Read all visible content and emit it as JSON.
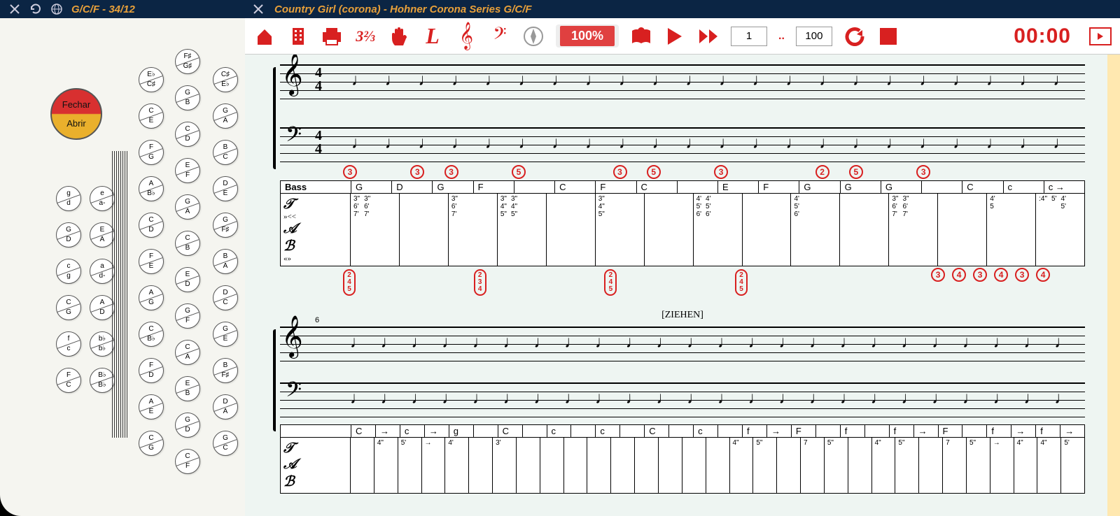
{
  "topbar": {
    "left_title": "G/C/F - 34/12",
    "right_title": "Country Girl (corona) - Hohner Corona Series G/C/F"
  },
  "fechar": "Fechar",
  "abrir": "Abrir",
  "accordion_buttons": {
    "col_a": [
      {
        "t": "g",
        "b": "d"
      },
      {
        "t": "G",
        "b": "D"
      },
      {
        "t": "c",
        "b": "g"
      },
      {
        "t": "C",
        "b": "G"
      },
      {
        "t": "f",
        "b": "c"
      },
      {
        "t": "F",
        "b": "C"
      }
    ],
    "col_b": [
      {
        "t": "e",
        "b": "a-"
      },
      {
        "t": "E",
        "b": "A"
      },
      {
        "t": "a",
        "b": "d-"
      },
      {
        "t": "A",
        "b": "D"
      },
      {
        "t": "b♭",
        "b": "b♭"
      },
      {
        "t": "B♭",
        "b": "B♭"
      }
    ],
    "col_c": [
      {
        "t": "E♭",
        "b": "C♯"
      },
      {
        "t": "C",
        "b": "E"
      },
      {
        "t": "F",
        "b": "G"
      },
      {
        "t": "A",
        "b": "B♭"
      },
      {
        "t": "C",
        "b": "D"
      },
      {
        "t": "F",
        "b": "E"
      },
      {
        "t": "A",
        "b": "G"
      },
      {
        "t": "C",
        "b": "B♭"
      },
      {
        "t": "F",
        "b": "D"
      },
      {
        "t": "A",
        "b": "E"
      },
      {
        "t": "C",
        "b": "G"
      }
    ],
    "col_d": [
      {
        "t": "F♯",
        "b": "G♯"
      },
      {
        "t": "G",
        "b": "B"
      },
      {
        "t": "C",
        "b": "D"
      },
      {
        "t": "E",
        "b": "F"
      },
      {
        "t": "G",
        "b": "A"
      },
      {
        "t": "C",
        "b": "B"
      },
      {
        "t": "E",
        "b": "D"
      },
      {
        "t": "G",
        "b": "F"
      },
      {
        "t": "C",
        "b": "A"
      },
      {
        "t": "E",
        "b": "B"
      },
      {
        "t": "G",
        "b": "D"
      },
      {
        "t": "C",
        "b": "F"
      }
    ],
    "col_e": [
      {
        "t": "C♯",
        "b": "E♭"
      },
      {
        "t": "G",
        "b": "A"
      },
      {
        "t": "B",
        "b": "C"
      },
      {
        "t": "D",
        "b": "E"
      },
      {
        "t": "G",
        "b": "F♯"
      },
      {
        "t": "B",
        "b": "A"
      },
      {
        "t": "D",
        "b": "C"
      },
      {
        "t": "G",
        "b": "E"
      },
      {
        "t": "B",
        "b": "F♯"
      },
      {
        "t": "D",
        "b": "A"
      },
      {
        "t": "G",
        "b": "C"
      }
    ]
  },
  "toolbar": {
    "speed": "100%",
    "from": "1",
    "to": "100",
    "dots": "..",
    "time": "00:00"
  },
  "score": {
    "time_sig_top": "4",
    "time_sig_bot": "4",
    "system1": {
      "circled_top": [
        "3",
        "",
        "3",
        "3",
        "",
        "5",
        "",
        "",
        "3",
        "5",
        "",
        "3",
        "",
        "",
        "2",
        "5",
        "",
        "3",
        "",
        "",
        "",
        ""
      ],
      "tab_header": [
        "Bass",
        "G",
        "D",
        "G",
        "F",
        "",
        "C",
        "F",
        "C",
        "",
        "E",
        "F",
        "G",
        "G",
        "G",
        "",
        "C",
        "c",
        "c →"
      ],
      "tab_push": "»<<",
      "tab_pull": "«»",
      "tab_cells": [
        {
          "push": [],
          "pull": [
            [
              "3\"",
              "6'",
              "7'"
            ],
            [
              "3\"",
              "6'",
              "7'"
            ]
          ]
        },
        {
          "push": [],
          "pull": []
        },
        {
          "push": [],
          "pull": [
            [
              "3\"",
              "6'",
              "7'"
            ]
          ]
        },
        {
          "push": [
            [
              "3\"",
              "4\"",
              "5\""
            ],
            [
              "3\"",
              "4\"",
              "5\""
            ]
          ],
          "pull": []
        },
        {
          "push": [],
          "pull": []
        },
        {
          "push": [
            [
              "3\"",
              "4\"",
              "5\""
            ]
          ],
          "pull": []
        },
        {
          "push": [],
          "pull": []
        },
        {
          "push": [
            [
              "4'",
              "5'",
              "6'"
            ],
            [
              "4'",
              "5'",
              "6'"
            ]
          ],
          "pull": []
        },
        {
          "push": [],
          "pull": []
        },
        {
          "push": [
            [
              "4'",
              "5'",
              "6'"
            ]
          ],
          "pull": []
        },
        {
          "push": [],
          "pull": []
        },
        {
          "push": [],
          "pull": [
            [
              "3\"",
              "6'",
              "7'"
            ],
            [
              "3\"",
              "6'",
              "7'"
            ]
          ]
        },
        {
          "push": [],
          "pull": []
        },
        {
          "push": [
            [
              "4'",
              "5"
            ]
          ],
          "pull": []
        },
        {
          "push": [
            [
              ":4\""
            ],
            [
              "5'"
            ],
            [
              "4'",
              "5'"
            ]
          ],
          "pull": []
        }
      ],
      "circled_bot_multi": [
        [
          "2",
          "4",
          "5"
        ],
        [
          "2",
          "3",
          "4"
        ],
        [
          "2",
          "4",
          "5"
        ],
        [
          "2",
          "4",
          "5"
        ]
      ],
      "circled_bot_single": [
        "3",
        "4",
        "3",
        "4",
        "3",
        "4"
      ]
    },
    "ziehen": "[ZIEHEN]",
    "system2": {
      "bar_num": "6",
      "tab_header": [
        "",
        "C",
        "→",
        "c",
        "→",
        "g",
        "",
        "C",
        "",
        "c",
        "",
        "c",
        "",
        "C",
        "",
        "c",
        "",
        "f",
        "→",
        "F",
        "",
        "f",
        "",
        "f",
        "→",
        "F",
        "",
        "f",
        "→",
        "f",
        "→"
      ],
      "tab_row": [
        "",
        "4\"",
        "5'",
        "→",
        "4'",
        "",
        "3'",
        "",
        "",
        "",
        "",
        "",
        "",
        "",
        "",
        "",
        "4\"",
        "5\"",
        "",
        "7",
        "5\"",
        "",
        "4\"",
        "5\"",
        "",
        "7",
        "5\"",
        "→",
        "4\"",
        "4\"",
        "5'"
      ]
    }
  }
}
